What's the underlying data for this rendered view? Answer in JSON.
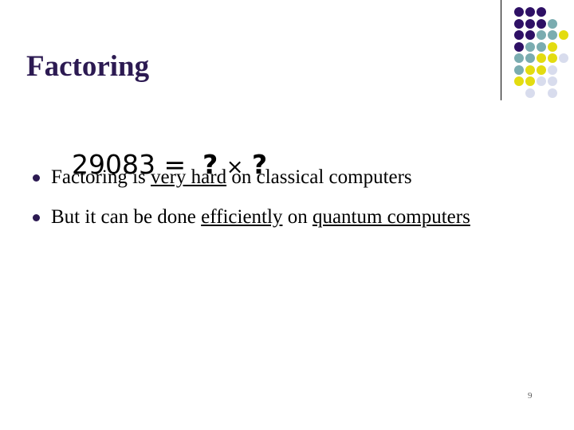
{
  "slide": {
    "title": "Factoring",
    "page_number": "9",
    "title_color": "#2c1a52",
    "background_color": "#ffffff"
  },
  "equation": {
    "left_operand": "29083",
    "equals": "=",
    "factor_a": "?",
    "operator": "×",
    "factor_b": "?",
    "full_text": "29083 = ? × ?"
  },
  "bullets": [
    {
      "marker": "•",
      "segments": [
        {
          "text": "Factoring is ",
          "underline": false
        },
        {
          "text": "very hard",
          "underline": true
        },
        {
          "text": " on classical computers",
          "underline": false
        }
      ],
      "plain_text": "Factoring is very hard on classical computers"
    },
    {
      "marker": "•",
      "segments": [
        {
          "text": "But it can be done ",
          "underline": false
        },
        {
          "text": "efficiently",
          "underline": true
        },
        {
          "text": " on ",
          "underline": false
        },
        {
          "text": "quantum computers",
          "underline": true
        }
      ],
      "plain_text": "But it can be done efficiently on quantum computers"
    }
  ],
  "decoration": {
    "divider_color": "#000000",
    "palette": {
      "purple": "#2e1065",
      "teal": "#7aacb0",
      "yellow": "#e3dc10",
      "lavender": "#d8dced",
      "blank": "transparent"
    },
    "dot_rows": [
      [
        "purple",
        "purple",
        "purple"
      ],
      [
        "purple",
        "purple",
        "purple",
        "teal"
      ],
      [
        "purple",
        "purple",
        "teal",
        "teal",
        "yellow"
      ],
      [
        "purple",
        "teal",
        "teal",
        "yellow"
      ],
      [
        "teal",
        "teal",
        "yellow",
        "yellow",
        "lavender"
      ],
      [
        "teal",
        "yellow",
        "yellow",
        "lavender"
      ],
      [
        "yellow",
        "yellow",
        "lavender",
        "lavender"
      ],
      [
        "blank",
        "lavender",
        "blank",
        "lavender"
      ]
    ]
  }
}
